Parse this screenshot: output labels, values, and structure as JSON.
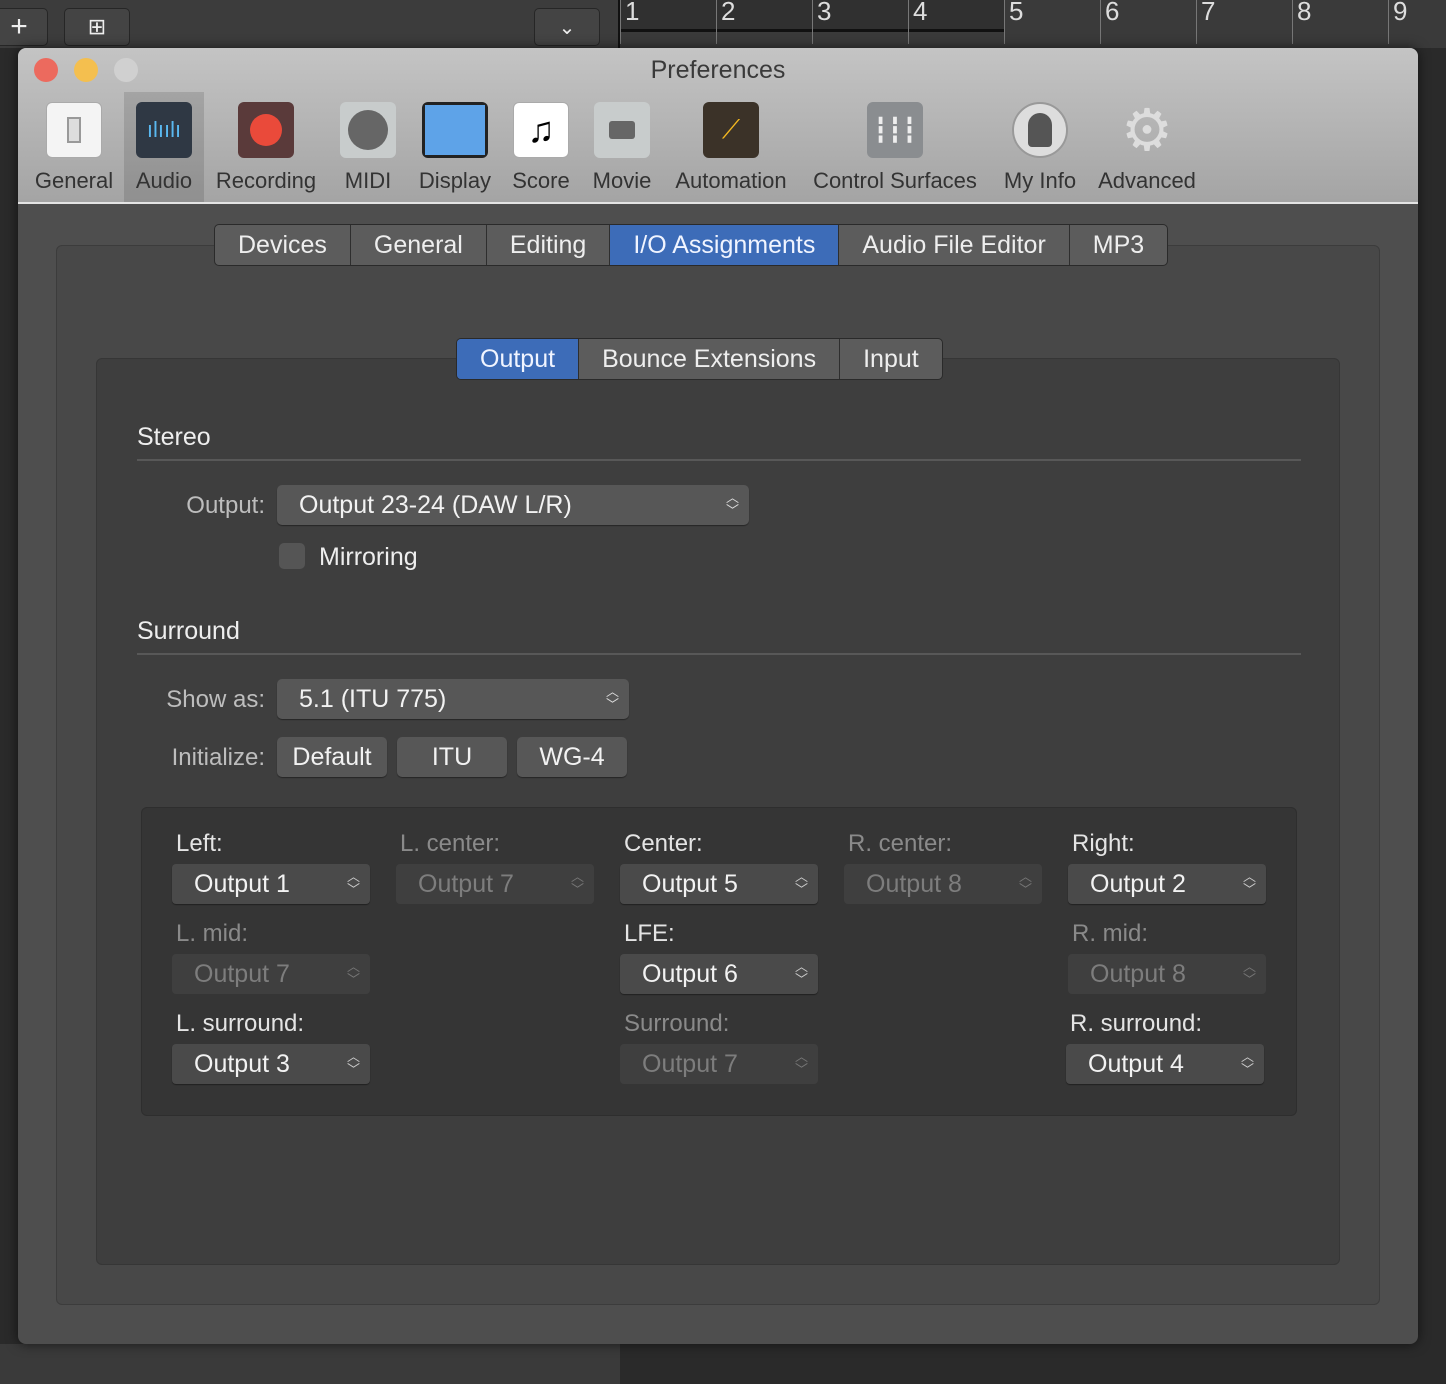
{
  "background": {
    "ruler_numbers": [
      "1",
      "2",
      "3",
      "4",
      "5",
      "6",
      "7",
      "8",
      "9"
    ]
  },
  "window": {
    "title": "Preferences"
  },
  "toolbar": [
    {
      "label": "General",
      "icon": "general-switch-icon"
    },
    {
      "label": "Audio",
      "icon": "audio-waveform-icon",
      "selected": true
    },
    {
      "label": "Recording",
      "icon": "record-icon"
    },
    {
      "label": "MIDI",
      "icon": "midi-connector-icon"
    },
    {
      "label": "Display",
      "icon": "display-monitor-icon"
    },
    {
      "label": "Score",
      "icon": "score-note-icon"
    },
    {
      "label": "Movie",
      "icon": "movie-camera-icon"
    },
    {
      "label": "Automation",
      "icon": "automation-icon"
    },
    {
      "label": "Control Surfaces",
      "icon": "faders-icon"
    },
    {
      "label": "My Info",
      "icon": "user-icon"
    },
    {
      "label": "Advanced",
      "icon": "gear-icon"
    }
  ],
  "tabs": [
    "Devices",
    "General",
    "Editing",
    "I/O Assignments",
    "Audio File Editor",
    "MP3"
  ],
  "selected_tab": "I/O Assignments",
  "subtabs": [
    "Output",
    "Bounce Extensions",
    "Input"
  ],
  "selected_subtab": "Output",
  "stereo": {
    "heading": "Stereo",
    "output_label": "Output:",
    "output_value": "Output 23-24 (DAW L/R)",
    "mirroring_label": "Mirroring",
    "mirroring_checked": false
  },
  "surround": {
    "heading": "Surround",
    "show_as_label": "Show as:",
    "show_as_value": "5.1 (ITU 775)",
    "initialize_label": "Initialize:",
    "init_buttons": [
      "Default",
      "ITU",
      "WG-4"
    ],
    "channels": [
      {
        "label": "Left:",
        "value": "Output 1",
        "enabled": true
      },
      {
        "label": "L. center:",
        "value": "Output 7",
        "enabled": false
      },
      {
        "label": "Center:",
        "value": "Output 5",
        "enabled": true
      },
      {
        "label": "R. center:",
        "value": "Output 8",
        "enabled": false
      },
      {
        "label": "Right:",
        "value": "Output 2",
        "enabled": true
      },
      {
        "label": "L. mid:",
        "value": "Output 7",
        "enabled": false
      },
      {
        "label": "LFE:",
        "value": "Output 6",
        "enabled": true
      },
      {
        "label": "R. mid:",
        "value": "Output 8",
        "enabled": false
      },
      {
        "label": "L. surround:",
        "value": "Output 3",
        "enabled": true
      },
      {
        "label": "Surround:",
        "value": "Output 7",
        "enabled": false
      },
      {
        "label": "R. surround:",
        "value": "Output 4",
        "enabled": true
      }
    ]
  },
  "colors": {
    "accent": "#3d6cb8",
    "close": "#ec6a5e",
    "minimize": "#f4bf4f",
    "zoom": "#d0d0d0"
  }
}
